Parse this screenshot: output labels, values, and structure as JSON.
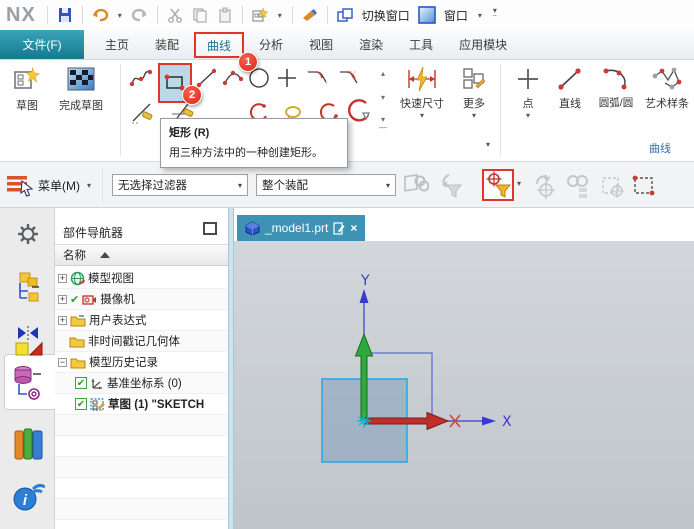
{
  "app": {
    "logo": "NX"
  },
  "titlebar": {
    "switch_window": "切换窗口",
    "window_label": "窗口"
  },
  "tabs": {
    "file": "文件(F)",
    "home": "主页",
    "assembly": "装配",
    "curve": "曲线",
    "analysis": "分析",
    "view": "视图",
    "render": "渲染",
    "tools": "工具",
    "app_modules": "应用模块"
  },
  "ribbon": {
    "sketch": "草图",
    "finish_sketch": "完成草图",
    "quick_dim": "快速尺寸",
    "more": "更多",
    "point": "点",
    "line": "直线",
    "arc_circle": "圆弧/圆",
    "art_spline": "艺术样条",
    "group_curve": "曲线"
  },
  "callouts": {
    "step1": "1",
    "step2": "2"
  },
  "tooltip": {
    "title": "矩形 (R)",
    "description": "用三种方法中的一种创建矩形。"
  },
  "selection_bar": {
    "menu": "菜单(M)",
    "filter_value": "无选择过滤器",
    "scope_value": "整个装配"
  },
  "part_navigator": {
    "title": "部件导航器",
    "column_name": "名称",
    "items": [
      {
        "label": "模型视图"
      },
      {
        "label": "摄像机"
      },
      {
        "label": "用户表达式"
      },
      {
        "label": "非时间戳记几何体"
      },
      {
        "label": "模型历史记录"
      },
      {
        "label": "基准坐标系 (0)"
      },
      {
        "label": "草图 (1) \"SKETCH"
      }
    ]
  },
  "viewport": {
    "tab_title": "_model1.prt",
    "axis_x_label": "X",
    "axis_y_label": "Y"
  },
  "colors": {
    "file_tab_teal": "#15798f",
    "highlight_red": "#e0352b",
    "viewport_tab": "#3e93b4",
    "axis_blue": "#3a3ad0",
    "axis_green": "#2fa83c",
    "axis_red": "#c03028",
    "sketch_fill": "#7d9bb9",
    "sketch_stroke": "#2da7e8",
    "group_label_blue": "#2f6fb0"
  }
}
